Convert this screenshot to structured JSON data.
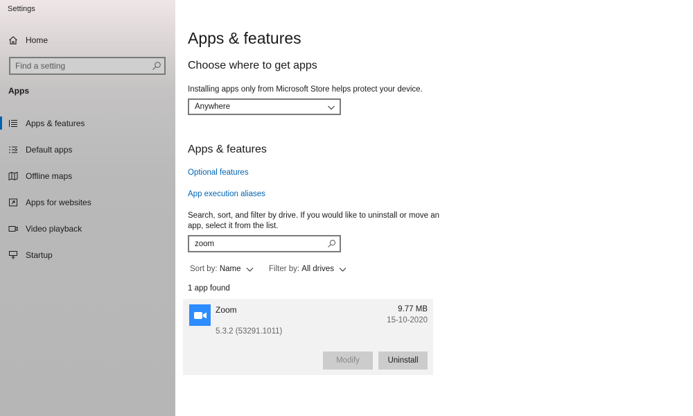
{
  "window": {
    "title": "Settings"
  },
  "sidebar": {
    "home_label": "Home",
    "search_placeholder": "Find a setting",
    "section_title": "Apps",
    "items": [
      {
        "label": "Apps & features",
        "icon": "apps-features-icon",
        "active": true
      },
      {
        "label": "Default apps",
        "icon": "default-apps-icon",
        "active": false
      },
      {
        "label": "Offline maps",
        "icon": "offline-maps-icon",
        "active": false
      },
      {
        "label": "Apps for websites",
        "icon": "apps-for-websites-icon",
        "active": false
      },
      {
        "label": "Video playback",
        "icon": "video-playback-icon",
        "active": false
      },
      {
        "label": "Startup",
        "icon": "startup-icon",
        "active": false
      }
    ]
  },
  "main": {
    "page_title": "Apps & features",
    "choose": {
      "heading": "Choose where to get apps",
      "description": "Installing apps only from Microsoft Store helps protect your device.",
      "dropdown_value": "Anywhere"
    },
    "apps": {
      "heading": "Apps & features",
      "link_optional": "Optional features",
      "link_aliases": "App execution aliases",
      "description_line1": "Search, sort, and filter by drive. If you would like to uninstall or move an",
      "description_line2": "app, select it from the list.",
      "search_value": "zoom",
      "sort_label": "Sort by:",
      "sort_value": "Name",
      "filter_label": "Filter by:",
      "filter_value": "All drives",
      "found_text": "1 app found",
      "list": [
        {
          "name": "Zoom",
          "version": "5.3.2 (53291.1011)",
          "size": "9.77 MB",
          "date": "15-10-2020",
          "modify_label": "Modify",
          "uninstall_label": "Uninstall"
        }
      ]
    }
  },
  "colors": {
    "accent": "#0063b1",
    "zoom_blue": "#2d8cff",
    "sidebar_bg": "#b9b9b9"
  }
}
